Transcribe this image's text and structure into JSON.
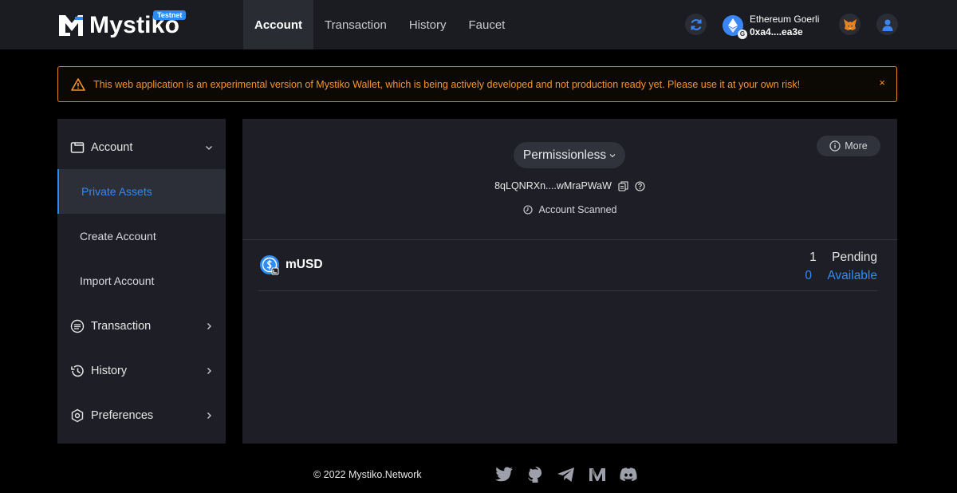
{
  "header": {
    "logo_text": "Mystiko",
    "badge": "Testnet",
    "nav": [
      {
        "label": "Account",
        "active": true
      },
      {
        "label": "Transaction",
        "active": false
      },
      {
        "label": "History",
        "active": false
      },
      {
        "label": "Faucet",
        "active": false
      }
    ],
    "network_name": "Ethereum Goerli",
    "network_badge": "G",
    "wallet_address": "0xa4....ea3e"
  },
  "warning": {
    "text": "This web application is an experimental version of Mystiko Wallet, which is being actively developed and not production ready yet. Please use it at your own risk!",
    "close": "×"
  },
  "sidebar": {
    "account": "Account",
    "sub_items": [
      "Private Assets",
      "Create Account",
      "Import Account"
    ],
    "transaction": "Transaction",
    "history": "History",
    "preferences": "Preferences"
  },
  "main": {
    "mode": "Permissionless",
    "more": "More",
    "account_address": "8qLQNRXn....wMraPWaW",
    "scan_status": "Account Scanned",
    "assets": [
      {
        "symbol": "mUSD",
        "pending": "1",
        "pending_label": "Pending",
        "available": "0",
        "available_label": "Available"
      }
    ]
  },
  "footer": {
    "copyright": "© 2022 Mystiko.Network"
  },
  "colors": {
    "accent": "#2f8bf5",
    "warning": "#f5962a",
    "panel": "#1e1f26",
    "header": "#1b1c22"
  }
}
